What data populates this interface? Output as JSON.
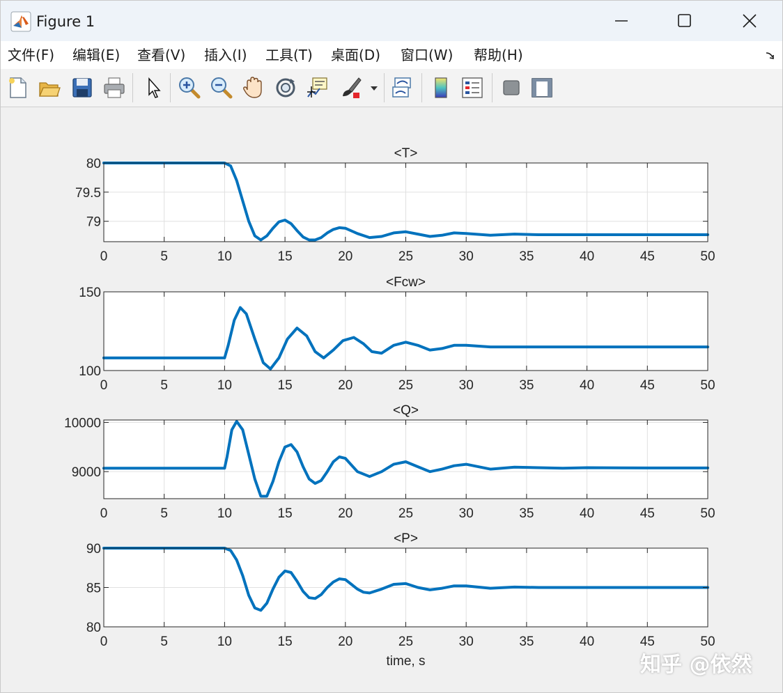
{
  "window": {
    "title": "Figure 1"
  },
  "menu": [
    "文件(F)",
    "编辑(E)",
    "查看(V)",
    "插入(I)",
    "工具(T)",
    "桌面(D)",
    "窗口(W)",
    "帮助(H)"
  ],
  "toolbar": [
    "new-figure-icon",
    "open-file-icon",
    "save-icon",
    "print-icon",
    "edit-plot-arrow-icon",
    "zoom-in-icon",
    "zoom-out-icon",
    "pan-hand-icon",
    "rotate-3d-icon",
    "data-cursor-icon",
    "brush-icon",
    "link-plot-icon",
    "colorbar-icon",
    "legend-icon",
    "hide-plot-tools-icon",
    "show-plot-tools-icon"
  ],
  "watermark": "知乎 @依然",
  "chart_data": [
    {
      "type": "line",
      "title": "<T>",
      "xlabel": "",
      "ylabel": "",
      "xlim": [
        0,
        50
      ],
      "ylim": [
        78.65,
        80
      ],
      "xticks": [
        0,
        5,
        10,
        15,
        20,
        25,
        30,
        35,
        40,
        45,
        50
      ],
      "yticks": [
        79,
        79.5,
        80
      ],
      "ytick_labels": [
        "79",
        "79.5",
        "80"
      ],
      "grid": true,
      "color": "#0072bd",
      "x": [
        0,
        10,
        10.5,
        11,
        11.5,
        12,
        12.5,
        13,
        13.5,
        14,
        14.5,
        15,
        15.5,
        16,
        16.5,
        17,
        17.5,
        18,
        18.5,
        19,
        19.5,
        20,
        21,
        22,
        23,
        24,
        25,
        26,
        27,
        28,
        29,
        30,
        32,
        34,
        36,
        38,
        40,
        45,
        50
      ],
      "y": [
        80,
        80,
        79.95,
        79.7,
        79.35,
        79.0,
        78.75,
        78.68,
        78.75,
        78.88,
        78.99,
        79.02,
        78.96,
        78.84,
        78.73,
        78.68,
        78.68,
        78.72,
        78.8,
        78.86,
        78.89,
        78.88,
        78.79,
        78.72,
        78.74,
        78.8,
        78.82,
        78.78,
        78.74,
        78.76,
        78.8,
        78.79,
        78.76,
        78.78,
        78.77,
        78.77,
        78.77,
        78.77,
        78.77
      ]
    },
    {
      "type": "line",
      "title": "<Fcw>",
      "xlabel": "",
      "ylabel": "",
      "xlim": [
        0,
        50
      ],
      "ylim": [
        100,
        150
      ],
      "xticks": [
        0,
        5,
        10,
        15,
        20,
        25,
        30,
        35,
        40,
        45,
        50
      ],
      "yticks": [
        100,
        150
      ],
      "ytick_labels": [
        "100",
        "150"
      ],
      "grid": true,
      "color": "#0072bd",
      "x": [
        0,
        10,
        10.3,
        10.8,
        11.3,
        11.8,
        12.5,
        13.2,
        13.8,
        14.5,
        15.2,
        16,
        16.8,
        17.5,
        18.2,
        19,
        19.8,
        20.7,
        21.5,
        22.2,
        23,
        24,
        25,
        26,
        27,
        28,
        29,
        30,
        32,
        34,
        36,
        38,
        40,
        42,
        45,
        50
      ],
      "y": [
        108,
        108,
        116,
        132,
        140,
        136,
        120,
        105,
        101,
        108,
        120,
        127,
        122,
        112,
        108,
        113,
        119,
        121,
        117,
        112,
        111,
        116,
        118,
        116,
        113,
        114,
        116,
        116,
        115,
        115,
        115,
        115,
        115,
        115,
        115,
        115
      ]
    },
    {
      "type": "line",
      "title": "<Q>",
      "xlabel": "",
      "ylabel": "",
      "xlim": [
        0,
        50
      ],
      "ylim": [
        8450,
        10050
      ],
      "xticks": [
        0,
        5,
        10,
        15,
        20,
        25,
        30,
        35,
        40,
        45,
        50
      ],
      "yticks": [
        9000,
        10000
      ],
      "ytick_labels": [
        "9000",
        "10000"
      ],
      "grid": true,
      "color": "#0072bd",
      "x": [
        0,
        10,
        10.2,
        10.6,
        11,
        11.5,
        12,
        12.5,
        13,
        13.5,
        14,
        14.5,
        15,
        15.5,
        16,
        16.5,
        17,
        17.5,
        18,
        18.5,
        19,
        19.5,
        20,
        21,
        22,
        23,
        24,
        25,
        26,
        27,
        28,
        29,
        30,
        32,
        34,
        36,
        38,
        40,
        45,
        50
      ],
      "y": [
        9070,
        9070,
        9300,
        9850,
        10020,
        9850,
        9350,
        8850,
        8500,
        8500,
        8800,
        9200,
        9500,
        9550,
        9400,
        9100,
        8850,
        8760,
        8820,
        9000,
        9200,
        9300,
        9270,
        9000,
        8900,
        9000,
        9150,
        9200,
        9100,
        9000,
        9050,
        9120,
        9150,
        9050,
        9090,
        9080,
        9070,
        9080,
        9075,
        9075
      ]
    },
    {
      "type": "line",
      "title": "<P>",
      "xlabel": "time, s",
      "ylabel": "",
      "xlim": [
        0,
        50
      ],
      "ylim": [
        80,
        90
      ],
      "xticks": [
        0,
        5,
        10,
        15,
        20,
        25,
        30,
        35,
        40,
        45,
        50
      ],
      "yticks": [
        80,
        85,
        90
      ],
      "ytick_labels": [
        "80",
        "85",
        "90"
      ],
      "grid": true,
      "color": "#0072bd",
      "x": [
        0,
        10,
        10.5,
        11,
        11.5,
        12,
        12.5,
        13,
        13.5,
        14,
        14.5,
        15,
        15.5,
        16,
        16.5,
        17,
        17.5,
        18,
        18.5,
        19,
        19.5,
        20,
        20.5,
        21,
        21.5,
        22,
        23,
        24,
        25,
        26,
        27,
        28,
        29,
        30,
        32,
        34,
        36,
        38,
        40,
        45,
        50
      ],
      "y": [
        90,
        90,
        89.7,
        88.5,
        86.5,
        84,
        82.4,
        82.1,
        83,
        84.8,
        86.3,
        87.1,
        86.9,
        85.8,
        84.5,
        83.7,
        83.6,
        84.1,
        85,
        85.7,
        86.1,
        86,
        85.4,
        84.8,
        84.4,
        84.3,
        84.8,
        85.4,
        85.5,
        85,
        84.7,
        84.9,
        85.2,
        85.2,
        84.9,
        85.05,
        85,
        85,
        85,
        85,
        85
      ]
    }
  ]
}
